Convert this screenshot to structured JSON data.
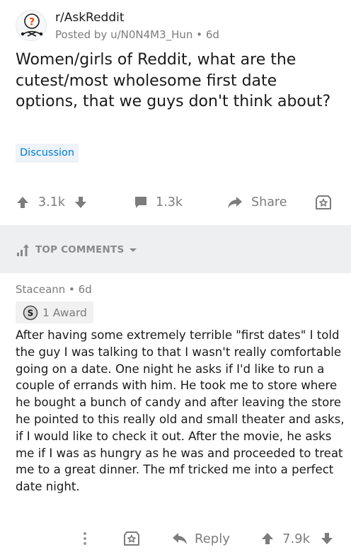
{
  "post": {
    "subreddit": "r/AskReddit",
    "posted_by": "Posted by u/N0N4M3_Hun • 6d",
    "title": "Women/girls of Reddit, what are the cutest/most wholesome first date options, that we guys don't think about?",
    "flair": "Discussion",
    "upvotes": "3.1k",
    "comments": "1.3k",
    "share_label": "Share"
  },
  "comments_section": {
    "sort_label": "TOP COMMENTS"
  },
  "comment": {
    "author_meta": "Staceann • 6d",
    "award": "1 Award",
    "body": "After having some extremely terrible \"first dates\" I told the guy I was talking to that I wasn't really comfortable going on a date. One night he asks if I'd like to run a couple of errands with him. He took me to store where he bought a bunch of candy and after leaving the store he pointed to this really old and small theater and asks, if I would like to check it out. After the movie, he asks me if I was as hungry as he was and proceeded to treat me to a great dinner. The mf tricked me into a perfect date night.",
    "reply_label": "Reply",
    "score": "7.9k"
  },
  "colors": {
    "text": "#1a1a1b",
    "meta": "#7c7c7c",
    "flair_bg": "#edf3f8",
    "flair_text": "#0079d3",
    "band": "#edeff1"
  },
  "icons": [
    "subreddit-avatar-icon",
    "upvote-arrow-icon",
    "downvote-arrow-icon",
    "comment-bubble-icon",
    "share-arrow-icon",
    "award-star-icon",
    "sort-bars-icon",
    "chevron-down-icon",
    "silver-award-icon",
    "more-options-icon",
    "reply-arrow-icon"
  ]
}
